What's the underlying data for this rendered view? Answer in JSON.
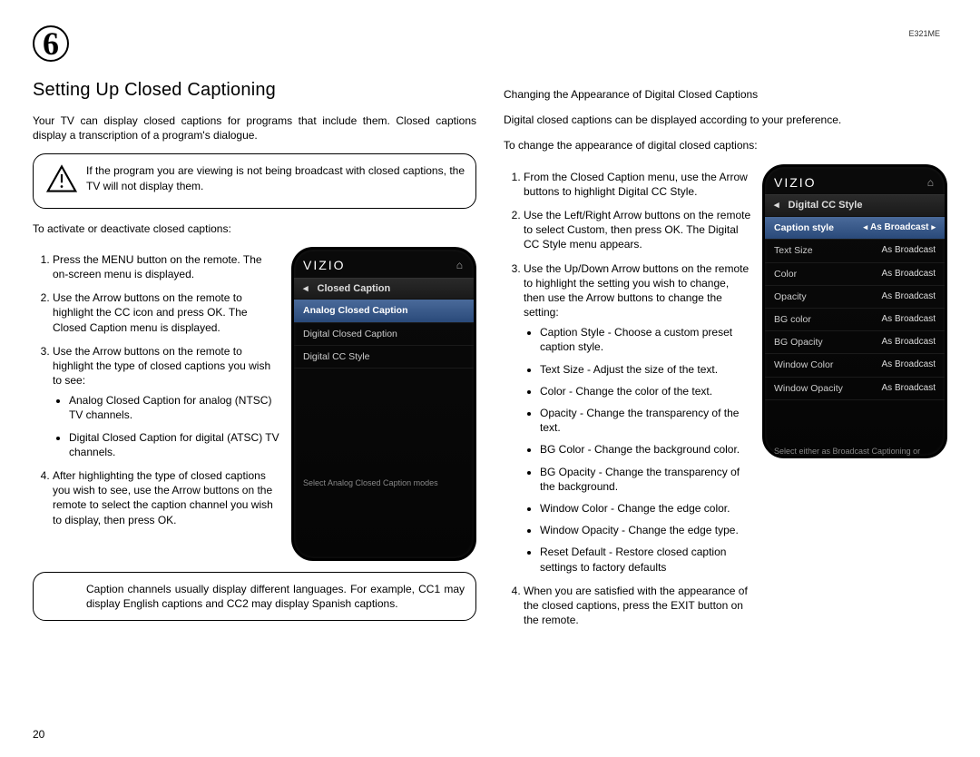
{
  "model": "E321ME",
  "page_number": "20",
  "chapter": "6",
  "left": {
    "heading": "Setting Up Closed Captioning",
    "intro": "Your TV can display closed captions for programs that include them. Closed captions display a transcription of a program's dialogue.",
    "warn": "If the program you are viewing is not being broadcast with closed captions, the TV will not display them.",
    "activate_intro": "To activate or deactivate closed captions:",
    "steps": {
      "s1": "Press the MENU button on the remote. The on-screen menu is displayed.",
      "s2": "Use the Arrow buttons on the remote to highlight the CC icon and press OK. The Closed Caption menu is displayed.",
      "s3": "Use the Arrow buttons on the remote to highlight the type of closed captions you wish to see:",
      "s3a": "Analog Closed Caption for analog (NTSC) TV channels.",
      "s3b": "Digital Closed Caption for digital (ATSC) TV channels.",
      "s4": "After highlighting the type of closed captions you wish to see, use the Arrow buttons on the remote to select the caption channel you wish to display, then press OK."
    },
    "note2": "Caption channels usually display different languages. For example, CC1 may display English captions and CC2 may display Spanish captions.",
    "menu": {
      "brand": "VIZIO",
      "title": "Closed Caption",
      "items": {
        "a": "Analog Closed Caption",
        "b": "Digital Closed Caption",
        "c": "Digital CC Style"
      },
      "tip": "Select Analog Closed Caption modes"
    }
  },
  "right": {
    "heading": "Changing the Appearance of Digital Closed Captions",
    "intro": "Digital closed captions can be displayed according to your preference.",
    "change_intro": "To change the appearance of digital closed captions:",
    "steps": {
      "s1": "From the Closed Caption menu, use the Arrow buttons to highlight Digital CC Style.",
      "s2": "Use the Left/Right Arrow buttons on the remote to select Custom, then press OK. The Digital CC Style menu appears.",
      "s3": "Use the Up/Down Arrow buttons on the remote to highlight the setting you wish to change, then use the Arrow buttons to change the setting:",
      "b1": "Caption Style - Choose a custom preset caption style.",
      "b2": "Text Size - Adjust the size of the text.",
      "b3": "Color - Change the color of the text.",
      "b4": "Opacity - Change the transparency of the text.",
      "b5": "BG Color - Change the background color.",
      "b6": "BG Opacity - Change the transparency of the background.",
      "b7": "Window Color - Change the edge color.",
      "b8": "Window Opacity - Change the edge type.",
      "b9": "Reset Default - Restore closed caption settings to factory defaults",
      "s4": "When you are satisfied with the appearance of the closed captions, press the EXIT button on the remote."
    },
    "menu": {
      "brand": "VIZIO",
      "title": "Digital CC Style",
      "rows": {
        "r1l": "Caption style",
        "r1v": "As Broadcast",
        "r2l": "Text Size",
        "r2v": "As Broadcast",
        "r3l": "Color",
        "r3v": "As Broadcast",
        "r4l": "Opacity",
        "r4v": "As Broadcast",
        "r5l": "BG color",
        "r5v": "As Broadcast",
        "r6l": "BG Opacity",
        "r6v": "As Broadcast",
        "r7l": "Window Color",
        "r7v": "As Broadcast",
        "r8l": "Window Opacity",
        "r8v": "As Broadcast"
      },
      "tip": "Select either as Broadcast Captioning or Custom to change size, color etc. ."
    }
  }
}
